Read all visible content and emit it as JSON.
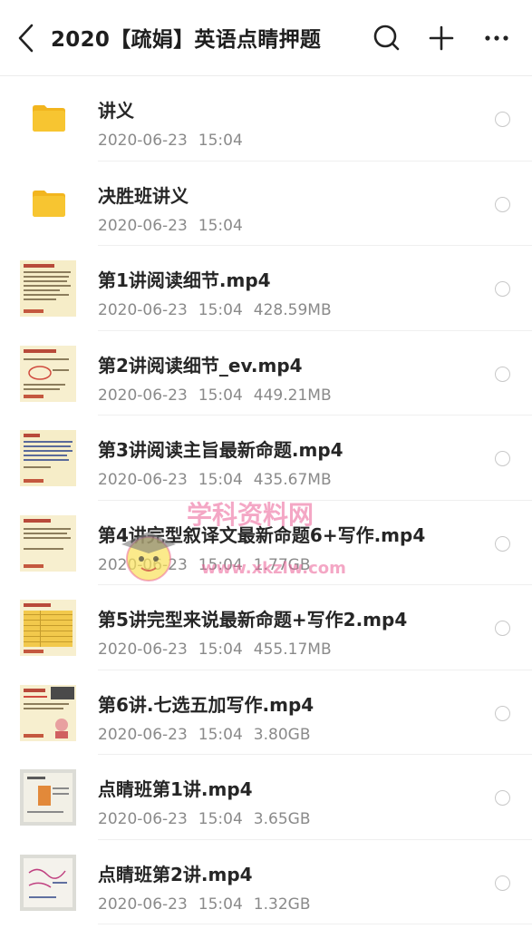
{
  "header": {
    "title": "2020【疏娟】英语点睛押题"
  },
  "files": [
    {
      "name": "讲义",
      "date": "2020-06-23",
      "time": "15:04",
      "size": "",
      "kind": "folder"
    },
    {
      "name": "决胜班讲义",
      "date": "2020-06-23",
      "time": "15:04",
      "size": "",
      "kind": "folder"
    },
    {
      "name": "第1讲阅读细节.mp4",
      "date": "2020-06-23",
      "time": "15:04",
      "size": "428.59MB",
      "kind": "video"
    },
    {
      "name": "第2讲阅读细节_ev.mp4",
      "date": "2020-06-23",
      "time": "15:04",
      "size": "449.21MB",
      "kind": "video"
    },
    {
      "name": "第3讲阅读主旨最新命题.mp4",
      "date": "2020-06-23",
      "time": "15:04",
      "size": "435.67MB",
      "kind": "video"
    },
    {
      "name": "第4讲完型叙译文最新命题6+写作.mp4",
      "date": "2020-06-23",
      "time": "15:04",
      "size": "1.77GB",
      "kind": "video"
    },
    {
      "name": "第5讲完型来说最新命题+写作2.mp4",
      "date": "2020-06-23",
      "time": "15:04",
      "size": "455.17MB",
      "kind": "video"
    },
    {
      "name": "第6讲.七选五加写作.mp4",
      "date": "2020-06-23",
      "time": "15:04",
      "size": "3.80GB",
      "kind": "video"
    },
    {
      "name": "点睛班第1讲.mp4",
      "date": "2020-06-23",
      "time": "15:04",
      "size": "3.65GB",
      "kind": "video"
    },
    {
      "name": "点睛班第2讲.mp4",
      "date": "2020-06-23",
      "time": "15:04",
      "size": "1.32GB",
      "kind": "video"
    }
  ],
  "watermark": {
    "line1": "学科资料网",
    "line2": "www.xkzlw.com"
  },
  "colors": {
    "folder": "#f7c531",
    "folder_tab": "#f2b51e",
    "title": "#1e1e1e",
    "meta": "#8a8a8a",
    "watermark": "#eb5f96"
  },
  "icons": {
    "back": "back-arrow-icon",
    "search": "search-icon",
    "add": "plus-icon",
    "more": "more-dots-icon",
    "folder": "folder-icon"
  }
}
